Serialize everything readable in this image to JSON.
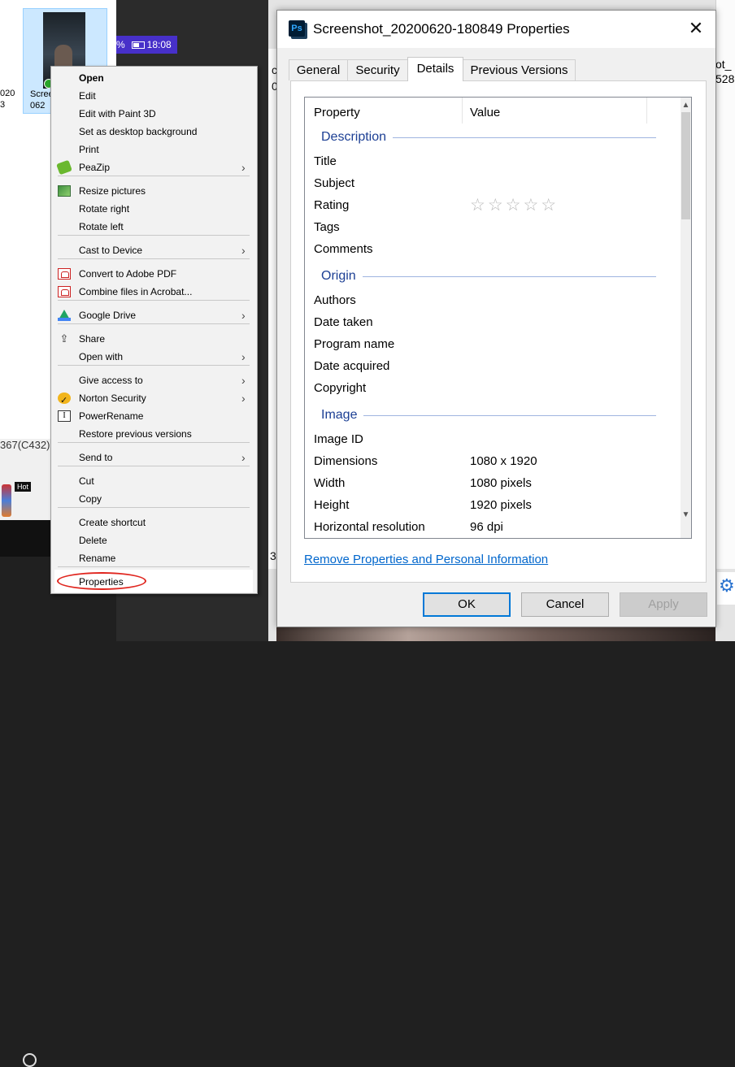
{
  "desktop": {
    "file_label": "Scree\n062",
    "side_text": "020\n3",
    "phone_time": "18:08",
    "phone_percent": "%",
    "code_text": "367(C432)",
    "hot_badge": "Hot",
    "right_text": "ot_\n528",
    "left_digit": "c\n0",
    "left_digit2": "3"
  },
  "context_menu": {
    "items": [
      {
        "label": "Open",
        "bold": true,
        "icon": ""
      },
      {
        "label": "Edit",
        "icon": ""
      },
      {
        "label": "Edit with Paint 3D",
        "icon": ""
      },
      {
        "label": "Set as desktop background",
        "icon": ""
      },
      {
        "label": "Print",
        "icon": ""
      },
      {
        "label": "PeaZip",
        "icon": "peazip-icon",
        "submenu": true
      },
      {
        "label": "Resize pictures",
        "icon": "resize-pictures-icon"
      },
      {
        "label": "Rotate right",
        "icon": ""
      },
      {
        "label": "Rotate left",
        "icon": ""
      },
      {
        "label": "Cast to Device",
        "icon": "",
        "submenu": true
      },
      {
        "label": "Convert to Adobe PDF",
        "icon": "adobe-pdf-icon"
      },
      {
        "label": "Combine files in Acrobat...",
        "icon": "acrobat-combine-icon"
      },
      {
        "label": "Google Drive",
        "icon": "google-drive-icon",
        "submenu": true
      },
      {
        "label": "Share",
        "icon": "share-icon"
      },
      {
        "label": "Open with",
        "icon": "",
        "submenu": true
      },
      {
        "label": "Give access to",
        "icon": "",
        "submenu": true
      },
      {
        "label": "Norton Security",
        "icon": "norton-icon",
        "submenu": true
      },
      {
        "label": "PowerRename",
        "icon": "powerrename-icon"
      },
      {
        "label": "Restore previous versions",
        "icon": ""
      },
      {
        "label": "Send to",
        "icon": "",
        "submenu": true
      },
      {
        "label": "Cut",
        "icon": ""
      },
      {
        "label": "Copy",
        "icon": ""
      },
      {
        "label": "Create shortcut",
        "icon": ""
      },
      {
        "label": "Delete",
        "icon": ""
      },
      {
        "label": "Rename",
        "icon": ""
      },
      {
        "label": "Properties",
        "icon": "",
        "highlighted": true
      }
    ],
    "submenu_arrow": "›"
  },
  "dialog": {
    "title": "Screenshot_20200620-180849 Properties",
    "close_glyph": "✕",
    "app_icon_text": "Ps",
    "tabs": [
      {
        "label": "General",
        "active": false
      },
      {
        "label": "Security",
        "active": false
      },
      {
        "label": "Details",
        "active": true
      },
      {
        "label": "Previous Versions",
        "active": false
      }
    ],
    "columns": {
      "property": "Property",
      "value": "Value"
    },
    "sections": [
      {
        "title": "Description",
        "rows": [
          {
            "key": "Title",
            "value": ""
          },
          {
            "key": "Subject",
            "value": ""
          },
          {
            "key": "Rating",
            "value": "",
            "stars": 5,
            "rating": 0
          },
          {
            "key": "Tags",
            "value": ""
          },
          {
            "key": "Comments",
            "value": ""
          }
        ]
      },
      {
        "title": "Origin",
        "rows": [
          {
            "key": "Authors",
            "value": ""
          },
          {
            "key": "Date taken",
            "value": ""
          },
          {
            "key": "Program name",
            "value": ""
          },
          {
            "key": "Date acquired",
            "value": ""
          },
          {
            "key": "Copyright",
            "value": ""
          }
        ]
      },
      {
        "title": "Image",
        "rows": [
          {
            "key": "Image ID",
            "value": ""
          },
          {
            "key": "Dimensions",
            "value": "1080 x 1920"
          },
          {
            "key": "Width",
            "value": "1080 pixels"
          },
          {
            "key": "Height",
            "value": "1920 pixels"
          },
          {
            "key": "Horizontal resolution",
            "value": "96 dpi"
          }
        ]
      }
    ],
    "remove_link": "Remove Properties and Personal Information",
    "buttons": {
      "ok": "OK",
      "cancel": "Cancel",
      "apply": "Apply"
    },
    "colors": {
      "section_title": "#1c3f94",
      "link": "#0066cc",
      "ok_border": "#0078d7",
      "oval": "#e0261f"
    }
  }
}
